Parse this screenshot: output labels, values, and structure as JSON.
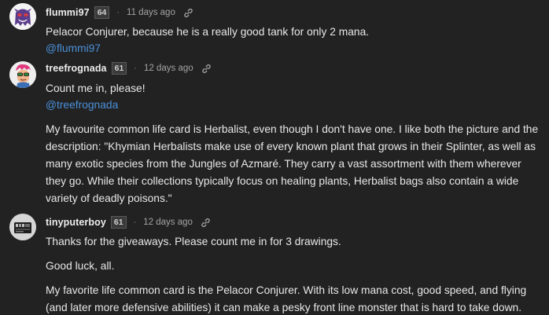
{
  "comments": [
    {
      "username": "flummi97",
      "reputation": "64",
      "separator": "·",
      "time": "11 days ago",
      "avatar_icon": "ghost-avatar-icon",
      "paragraphs": [
        "Pelacor Conjurer, because he is a really good tank for only 2 mana."
      ],
      "mention": "@flummi97"
    },
    {
      "username": "treefrognada",
      "reputation": "61",
      "separator": "·",
      "time": "12 days ago",
      "avatar_icon": "cartoon-face-avatar-icon",
      "paragraphs": [
        "Count me in, please!",
        "My favourite common life card is Herbalist, even though I don't have one. I like both the picture and the description: \"Khymian Herbalists make use of every known plant that grows in their Splinter, as well as many exotic species from the Jungles of Azmaré. They carry a vast assortment with them wherever they go. While their collections typically focus on healing plants, Herbalist bags also contain a wide variety of deadly poisons.\""
      ],
      "mention": "@treefrognada"
    },
    {
      "username": "tinyputerboy",
      "reputation": "61",
      "separator": "·",
      "time": "12 days ago",
      "avatar_icon": "computer-board-avatar-icon",
      "paragraphs": [
        "Thanks for the giveaways. Please count me in for 3 drawings.",
        "Good luck, all.",
        "My favorite life common card is the Pelacor Conjurer. With its low mana cost, good speed, and flying (and later more defensive abilities) it can make a pesky front line monster that is hard to take down."
      ]
    }
  ],
  "colors": {
    "background": "#222222",
    "text": "#e8e8e8",
    "mention": "#4a90d9",
    "muted": "#a3a3a3"
  }
}
